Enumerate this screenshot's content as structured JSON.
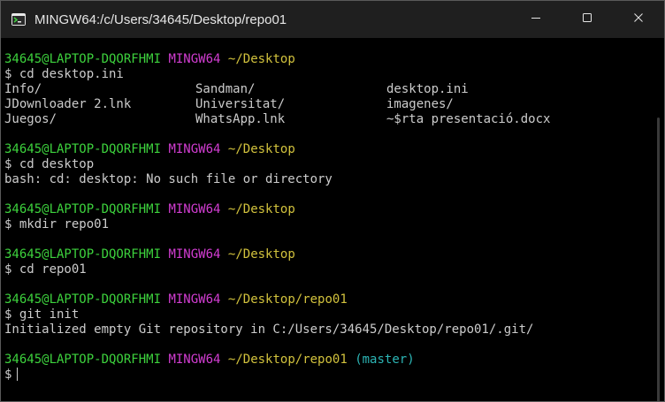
{
  "window": {
    "title": "MINGW64:/c/Users/34645/Desktop/repo01",
    "icons": {
      "app": "mingw-terminal-icon",
      "minimize": "minimize-icon",
      "maximize": "maximize-icon",
      "close": "close-icon"
    }
  },
  "colors": {
    "user_host": "#3dd23d",
    "shell": "#d23dd2",
    "path": "#d2c23d",
    "branch": "#2cb5b5",
    "text": "#cccccc",
    "background": "#000000"
  },
  "terminal": {
    "blocks": [
      {
        "prompt": {
          "user": "34645@LAPTOP-DQORFHMI",
          "shell": "MINGW64",
          "path": "~/Desktop"
        },
        "command": "$ cd desktop.ini",
        "listing": [
          [
            "Info/",
            "Sandman/",
            "desktop.ini"
          ],
          [
            "JDownloader 2.lnk",
            "Universitat/",
            "imagenes/"
          ],
          [
            "Juegos/",
            "WhatsApp.lnk",
            "~$rta presentació.docx"
          ]
        ]
      },
      {
        "prompt": {
          "user": "34645@LAPTOP-DQORFHMI",
          "shell": "MINGW64",
          "path": "~/Desktop"
        },
        "command": "$ cd desktop",
        "output": "bash: cd: desktop: No such file or directory"
      },
      {
        "prompt": {
          "user": "34645@LAPTOP-DQORFHMI",
          "shell": "MINGW64",
          "path": "~/Desktop"
        },
        "command": "$ mkdir repo01"
      },
      {
        "prompt": {
          "user": "34645@LAPTOP-DQORFHMI",
          "shell": "MINGW64",
          "path": "~/Desktop"
        },
        "command": "$ cd repo01"
      },
      {
        "prompt": {
          "user": "34645@LAPTOP-DQORFHMI",
          "shell": "MINGW64",
          "path": "~/Desktop/repo01"
        },
        "command": "$ git init",
        "output": "Initialized empty Git repository in C:/Users/34645/Desktop/repo01/.git/"
      },
      {
        "prompt": {
          "user": "34645@LAPTOP-DQORFHMI",
          "shell": "MINGW64",
          "path": "~/Desktop/repo01",
          "branch": "(master)"
        },
        "command": "$"
      }
    ]
  }
}
